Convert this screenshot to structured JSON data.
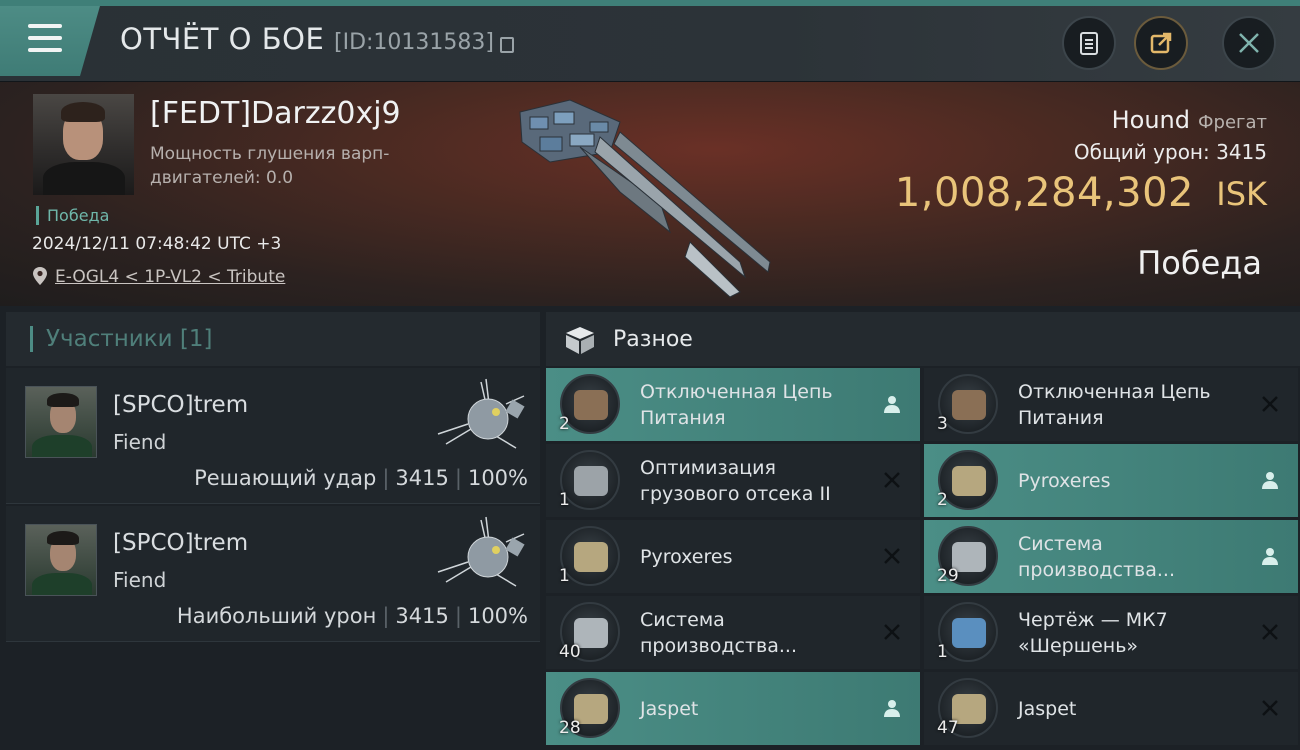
{
  "header": {
    "title": "ОТЧЁТ О БОЕ",
    "report_id": "[ID:10131583]"
  },
  "hero": {
    "pilot_name": "[FEDT]Darzz0xj9",
    "warp_jam": "Мощность глушения варп-двигателей: 0.0",
    "result_small": "Победа",
    "timestamp": "2024/12/11 07:48:42 UTC +3",
    "location": "E-OGL4 < 1P-VL2 < Tribute",
    "ship_name": "Hound",
    "ship_class": "Фрегат",
    "total_damage": "Общий урон: 3415",
    "isk_value": "1,008,284,302",
    "isk_unit": "ISK",
    "result_big": "Победа"
  },
  "participants": {
    "title": "Участники [1]",
    "rows": [
      {
        "name": "[SPCO]trem",
        "ship": "Fiend",
        "label": "Решающий удар",
        "damage": "3415",
        "percent": "100%"
      },
      {
        "name": "[SPCO]trem",
        "ship": "Fiend",
        "label": "Наибольший урон",
        "damage": "3415",
        "percent": "100%"
      }
    ]
  },
  "misc": {
    "title": "Разное",
    "items": [
      {
        "name": "Отключенная Цепь Питания",
        "qty": "2",
        "status": "dropped",
        "icon": "component-icon"
      },
      {
        "name": "Отключенная Цепь Питания",
        "qty": "3",
        "status": "destroyed",
        "icon": "component-icon"
      },
      {
        "name": "Оптимизация грузового отсека II",
        "qty": "1",
        "status": "destroyed",
        "icon": "cargo-rig-icon"
      },
      {
        "name": "Pyroxeres",
        "qty": "2",
        "status": "dropped",
        "icon": "ore-icon"
      },
      {
        "name": "Pyroxeres",
        "qty": "1",
        "status": "destroyed",
        "icon": "ore-icon"
      },
      {
        "name": "Система производства...",
        "qty": "29",
        "status": "dropped",
        "icon": "production-system-icon"
      },
      {
        "name": "Система производства...",
        "qty": "40",
        "status": "destroyed",
        "icon": "production-system-icon"
      },
      {
        "name": "Чертёж — МК7 «Шершень»",
        "qty": "1",
        "status": "destroyed",
        "icon": "blueprint-icon"
      },
      {
        "name": "Jaspet",
        "qty": "28",
        "status": "dropped",
        "icon": "ore-icon"
      },
      {
        "name": "Jaspet",
        "qty": "47",
        "status": "destroyed",
        "icon": "ore-icon"
      }
    ]
  },
  "colors": {
    "accent_teal": "#4b8e86",
    "isk_gold": "#e9c47a",
    "victory_green": "#6fb7aa"
  }
}
